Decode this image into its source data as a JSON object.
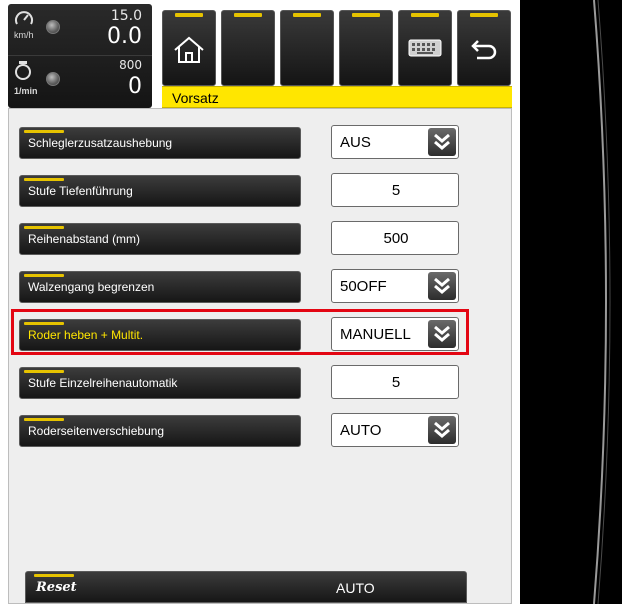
{
  "status": {
    "speed_max": "15.0",
    "speed_value": "0.0",
    "speed_unit": "km/h",
    "rpm_max": "800",
    "rpm_value": "0",
    "rpm_unit": "1/min"
  },
  "toolbar": {
    "buttons": [
      "home-icon",
      "",
      "",
      "",
      "keyboard-icon",
      "back-icon"
    ]
  },
  "screen": {
    "title": "Vorsatz"
  },
  "params": [
    {
      "label": "Schleglerzusatzaushebung",
      "value": "AUS",
      "type": "dropdown"
    },
    {
      "label": "Stufe Tiefenführung",
      "value": "5",
      "type": "number"
    },
    {
      "label": "Reihenabstand (mm)",
      "value": "500",
      "type": "number"
    },
    {
      "label": "Walzengang begrenzen",
      "value": "50OFF",
      "type": "dropdown"
    },
    {
      "label": "Roder heben + Multit.",
      "value": "MANUELL",
      "type": "dropdown",
      "selected": true
    },
    {
      "label": "Stufe Einzelreihenautomatik",
      "value": "5",
      "type": "number"
    },
    {
      "label": "Roderseitenverschiebung",
      "value": "AUTO",
      "type": "dropdown"
    }
  ],
  "reset": {
    "label": "Reset",
    "value": "AUTO"
  },
  "colors": {
    "accent_yellow": "#ffe600",
    "highlight_red": "#e30613",
    "button_dark": "#1e1e1e",
    "panel_bg": "#eeeeee"
  }
}
